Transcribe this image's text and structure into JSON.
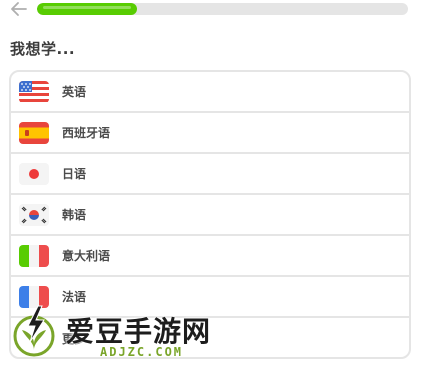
{
  "header": {
    "back_icon": "arrow-left-icon",
    "progress": 0.27,
    "progress_color": "#58cc02"
  },
  "title": "我想学...",
  "languages": [
    {
      "label": "英语",
      "flag_icon": "flag-us-icon"
    },
    {
      "label": "西班牙语",
      "flag_icon": "flag-es-icon"
    },
    {
      "label": "日语",
      "flag_icon": "flag-jp-icon"
    },
    {
      "label": "韩语",
      "flag_icon": "flag-kr-icon"
    },
    {
      "label": "意大利语",
      "flag_icon": "flag-it-icon"
    },
    {
      "label": "法语",
      "flag_icon": "flag-fr-icon"
    },
    {
      "label": "更多",
      "flag_icon": "more-icon"
    }
  ],
  "watermark": {
    "text": "爱豆手游网",
    "url": "ADJZC.COM"
  }
}
